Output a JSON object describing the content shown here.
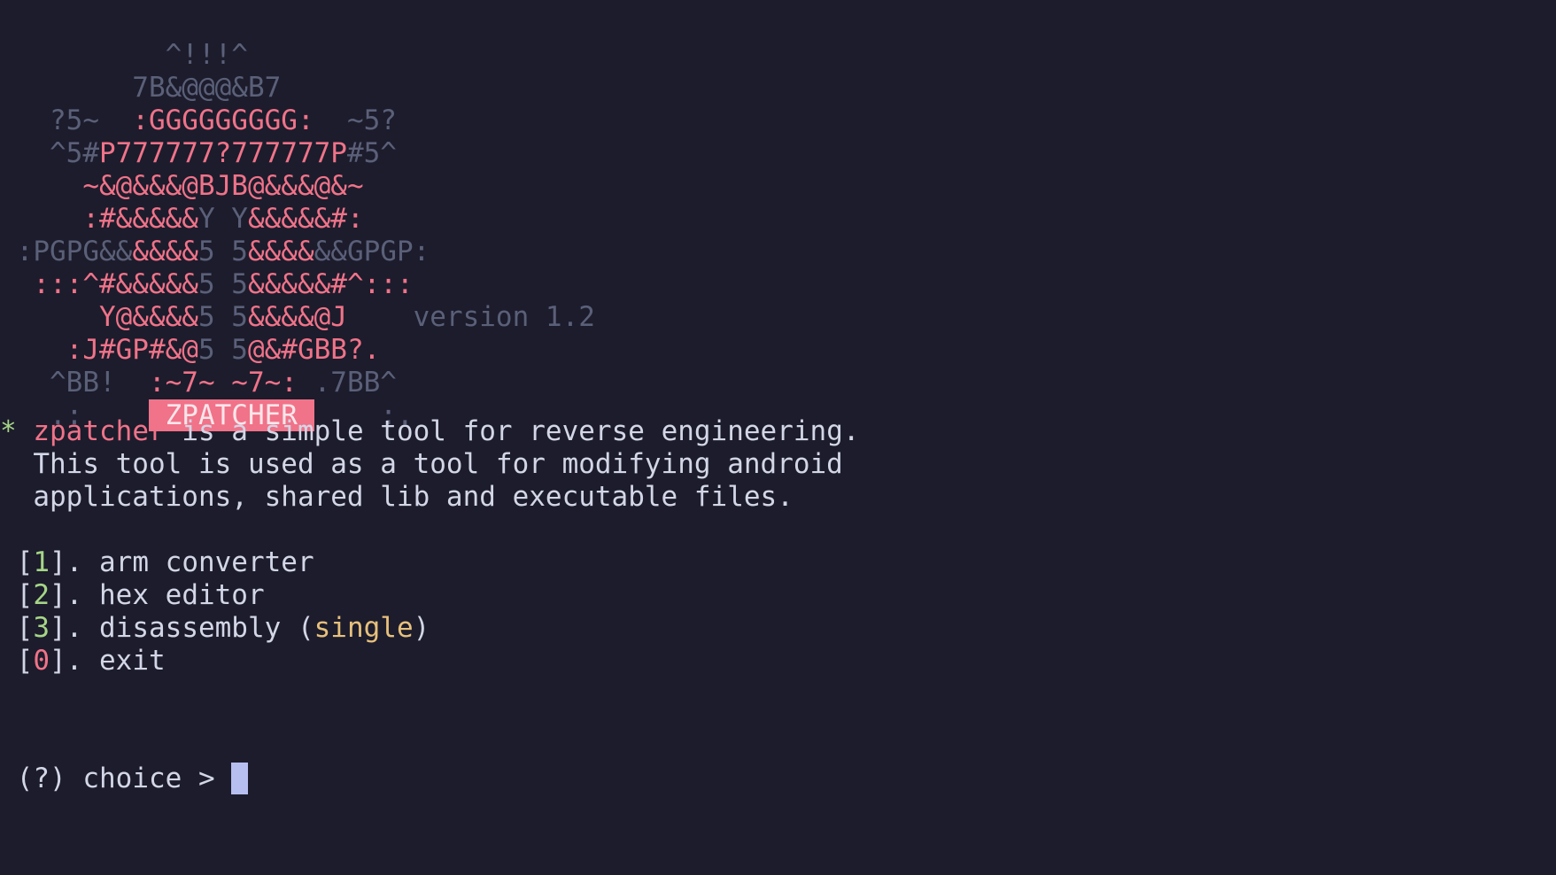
{
  "logo": {
    "lines": [
      [
        {
          "t": "          ^!!!^",
          "c": "dim"
        }
      ],
      [
        {
          "t": "        7B&@@@&B7",
          "c": "dim"
        }
      ],
      [
        {
          "t": "   ?5~  ",
          "c": "dim"
        },
        {
          "t": ":GGGGGGGGG:",
          "c": "pink"
        },
        {
          "t": "  ~5?",
          "c": "dim"
        }
      ],
      [
        {
          "t": "   ^5#",
          "c": "dim"
        },
        {
          "t": "P777777?777777P",
          "c": "pink"
        },
        {
          "t": "#5^",
          "c": "dim"
        }
      ],
      [
        {
          "t": "     ",
          "c": "dim"
        },
        {
          "t": "~&@&&&@BJB@&&&@&~",
          "c": "pink"
        }
      ],
      [
        {
          "t": "     ",
          "c": "dim"
        },
        {
          "t": ":#&&&&&",
          "c": "pink"
        },
        {
          "t": "Y Y",
          "c": "dim"
        },
        {
          "t": "&&&&&#:",
          "c": "pink"
        }
      ],
      [
        {
          "t": " :PGPG&&",
          "c": "dim"
        },
        {
          "t": "&&&&",
          "c": "pink"
        },
        {
          "t": "5 5",
          "c": "dim"
        },
        {
          "t": "&&&&",
          "c": "pink"
        },
        {
          "t": "&&GPGP:",
          "c": "dim"
        }
      ],
      [
        {
          "t": "  ",
          "c": "dim"
        },
        {
          "t": ":::^#&&&&&",
          "c": "pink"
        },
        {
          "t": "5 5",
          "c": "dim"
        },
        {
          "t": "&&&&&#^:::",
          "c": "pink"
        }
      ],
      [
        {
          "t": "      ",
          "c": "dim"
        },
        {
          "t": "Y@&&&&",
          "c": "pink"
        },
        {
          "t": "5 5",
          "c": "dim"
        },
        {
          "t": "&&&&@J",
          "c": "pink"
        },
        {
          "t": "    version 1.2",
          "c": "dim"
        }
      ],
      [
        {
          "t": "    ",
          "c": "dim"
        },
        {
          "t": ":J#GP#&@",
          "c": "pink"
        },
        {
          "t": "5 5",
          "c": "dim"
        },
        {
          "t": "@&#GBB?.",
          "c": "pink"
        }
      ],
      [
        {
          "t": "   ^BB!  ",
          "c": "dim"
        },
        {
          "t": ":~7~ ~7~:",
          "c": "pink"
        },
        {
          "t": " .7BB^",
          "c": "dim"
        }
      ],
      [
        {
          "t": "   .:    ",
          "c": "dim"
        },
        {
          "t": " ZPATCHER ",
          "c": "badge"
        },
        {
          "t": "    :.",
          "c": "dim"
        }
      ]
    ]
  },
  "description": {
    "bullet": "*",
    "tool_name": "zpatcher",
    "line1_rest": " is a simple tool for reverse engineering.",
    "line2": "This tool is used as a tool for modifying android",
    "line3": "applications, shared lib and executable files."
  },
  "menu": [
    {
      "key": "1",
      "key_color": "green",
      "label": "arm converter",
      "extra": "",
      "extra_close": ""
    },
    {
      "key": "2",
      "key_color": "green",
      "label": "hex editor",
      "extra": "",
      "extra_close": ""
    },
    {
      "key": "3",
      "key_color": "green",
      "label": "disassembly (",
      "extra": "single",
      "extra_close": ")"
    },
    {
      "key": "0",
      "key_color": "red",
      "label": "exit",
      "extra": "",
      "extra_close": ""
    }
  ],
  "prompt": {
    "text": "(?) choice > "
  }
}
